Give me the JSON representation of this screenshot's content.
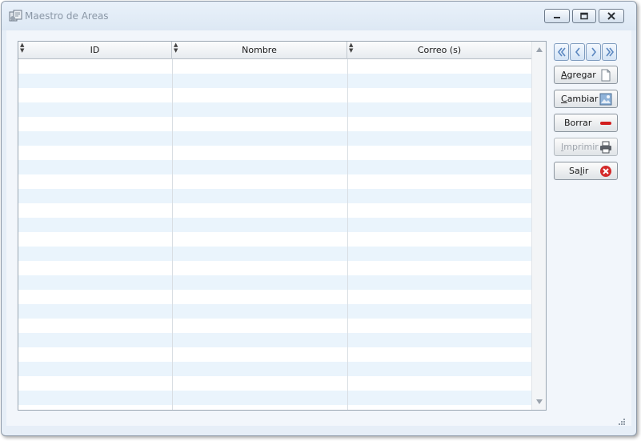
{
  "window": {
    "title": "Maestro de Areas",
    "title_icon": "app-icon",
    "controls": [
      "minimize-icon",
      "maximize-icon",
      "close-icon"
    ]
  },
  "grid": {
    "columns": [
      {
        "label": "ID"
      },
      {
        "label": "Nombre"
      },
      {
        "label": "Correo (s)"
      }
    ],
    "rows": [],
    "row_stripe_color": "#eaf4fc"
  },
  "navigation": {
    "buttons": [
      "first-record-icon",
      "previous-record-icon",
      "next-record-icon",
      "last-record-icon"
    ],
    "accent": "#5a86c0"
  },
  "actions": {
    "agregar": {
      "label": "Agregar",
      "mnemonic": "A",
      "icon": "new-document-icon"
    },
    "cambiar": {
      "label": "Cambiar",
      "mnemonic": "C",
      "icon": "edit-image-icon"
    },
    "borrar": {
      "label": "Borrar",
      "icon": "delete-icon",
      "color": "#d21e1e"
    },
    "imprimir": {
      "label": "Imprimir",
      "mnemonic": "I",
      "icon": "printer-icon",
      "enabled": false
    },
    "salir": {
      "label": "Salir",
      "mnemonic": "l",
      "icon": "exit-icon",
      "color": "#d32a2a"
    }
  }
}
